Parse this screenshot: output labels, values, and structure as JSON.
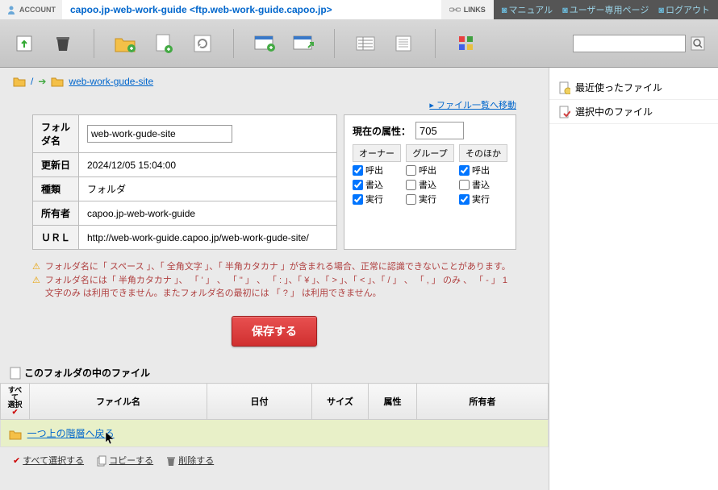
{
  "header": {
    "account_label": "ACCOUNT",
    "account_info": "capoo.jp-web-work-guide <ftp.web-work-guide.capoo.jp>",
    "links_label": "LINKS",
    "links": {
      "manual": "マニュアル",
      "userpage": "ユーザー専用ページ",
      "logout": "ログアウト"
    }
  },
  "search": {
    "placeholder": ""
  },
  "breadcrumb": {
    "root_icon": "folder",
    "arrow": "➔",
    "current": "web-work-gude-site"
  },
  "filelist_link": "ファイル一覧へ移動",
  "details": {
    "rows": {
      "folder_name": {
        "label": "フォルダ名",
        "value": "web-work-gude-site"
      },
      "updated": {
        "label": "更新日",
        "value": "2024/12/05 15:04:00"
      },
      "type": {
        "label": "種類",
        "value": "フォルダ"
      },
      "owner": {
        "label": "所有者",
        "value": "capoo.jp-web-work-guide"
      },
      "url": {
        "label": "ＵＲＬ",
        "value": "http://web-work-guide.capoo.jp/web-work-gude-site/"
      }
    }
  },
  "attributes": {
    "label": "現在の属性：",
    "value": "705",
    "columns": {
      "owner": "オーナー",
      "group": "グループ",
      "other": "そのほか"
    },
    "perms": {
      "read": "呼出",
      "write": "書込",
      "exec": "実行"
    },
    "checks": {
      "owner": {
        "read": true,
        "write": true,
        "exec": true
      },
      "group": {
        "read": false,
        "write": false,
        "exec": false
      },
      "other": {
        "read": true,
        "write": false,
        "exec": true
      }
    }
  },
  "notes": {
    "n1": "フォルダ名に「 スペース 」、「 全角文字 」、「 半角カタカナ 」が含まれる場合、正常に認識できないことがあります。",
    "n2": "フォルダ名には「 半角カタカナ 」、 「 ' 」 、 「 \" 」 、 「 : 」、「 ¥ 」、「 > 」、「 < 」、「 / 」 、 「 , 」 のみ 、 「 - 」 1文字のみ は利用できません。またフォルダ名の最初には 「 ? 」 は利用できません。"
  },
  "save_button": "保存する",
  "folder_contents_header": "このフォルダの中のファイル",
  "file_table": {
    "headers": {
      "selectall": "すべて\n選択",
      "name": "ファイル名",
      "date": "日付",
      "size": "サイズ",
      "attr": "属性",
      "owner": "所有者"
    },
    "up_link": "一つ上の階層へ戻る"
  },
  "bottom_actions": {
    "select_all": "すべて選択する",
    "copy": "コピーする",
    "delete": "削除する"
  },
  "sidebar": {
    "recent": "最近使ったファイル",
    "selected": "選択中のファイル"
  }
}
